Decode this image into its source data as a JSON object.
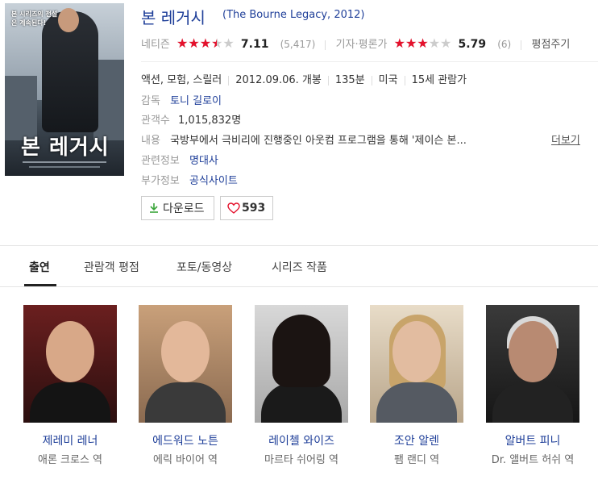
{
  "movie": {
    "title_ko": "본 레거시",
    "title_en": "(The Bourne Legacy, 2012)",
    "poster": {
      "tagline": "본 시리즈의 전설은 계속된다!",
      "title": "본 레거시"
    }
  },
  "ratings": {
    "netizen": {
      "label": "네티즌",
      "stars": 3.5,
      "score": "7.11",
      "count": "(5,417)"
    },
    "critic": {
      "label": "기자·평론가",
      "stars": 3,
      "score": "5.79",
      "count": "(6)"
    },
    "rate_link": "평점주기"
  },
  "info": {
    "genre": "액션, 모험, 스릴러",
    "release": "2012.09.06. 개봉",
    "runtime": "135분",
    "country": "미국",
    "age": "15세 관람가",
    "director_label": "감독",
    "director": "토니 길로이",
    "audience_label": "관객수",
    "audience": "1,015,832명",
    "synopsis_label": "내용",
    "synopsis": "국방부에서 극비리에 진행중인 아웃컴 프로그램을 통해 '제이슨 본...",
    "more": "더보기",
    "related_label": "관련정보",
    "related": "명대사",
    "extra_label": "부가정보",
    "extra": "공식사이트"
  },
  "buttons": {
    "download": "다운로드",
    "like_count": "593"
  },
  "tabs": [
    "출연",
    "관람객 평점",
    "포토/동영상",
    "시리즈 작품"
  ],
  "cast": [
    {
      "name": "제레미 레너",
      "role": "애론 크로스 역"
    },
    {
      "name": "에드워드 노튼",
      "role": "에릭 바이어 역"
    },
    {
      "name": "레이첼 와이즈",
      "role": "마르타 쉬어링 역"
    },
    {
      "name": "조안 알렌",
      "role": "팸 랜디 역"
    },
    {
      "name": "알버트 피니",
      "role": "Dr. 앨버트 허쉬 역"
    }
  ],
  "colors": {
    "link": "#1f3f99",
    "star": "#e4112c",
    "like": "#e4112c",
    "download_icon": "#3aa53a"
  }
}
